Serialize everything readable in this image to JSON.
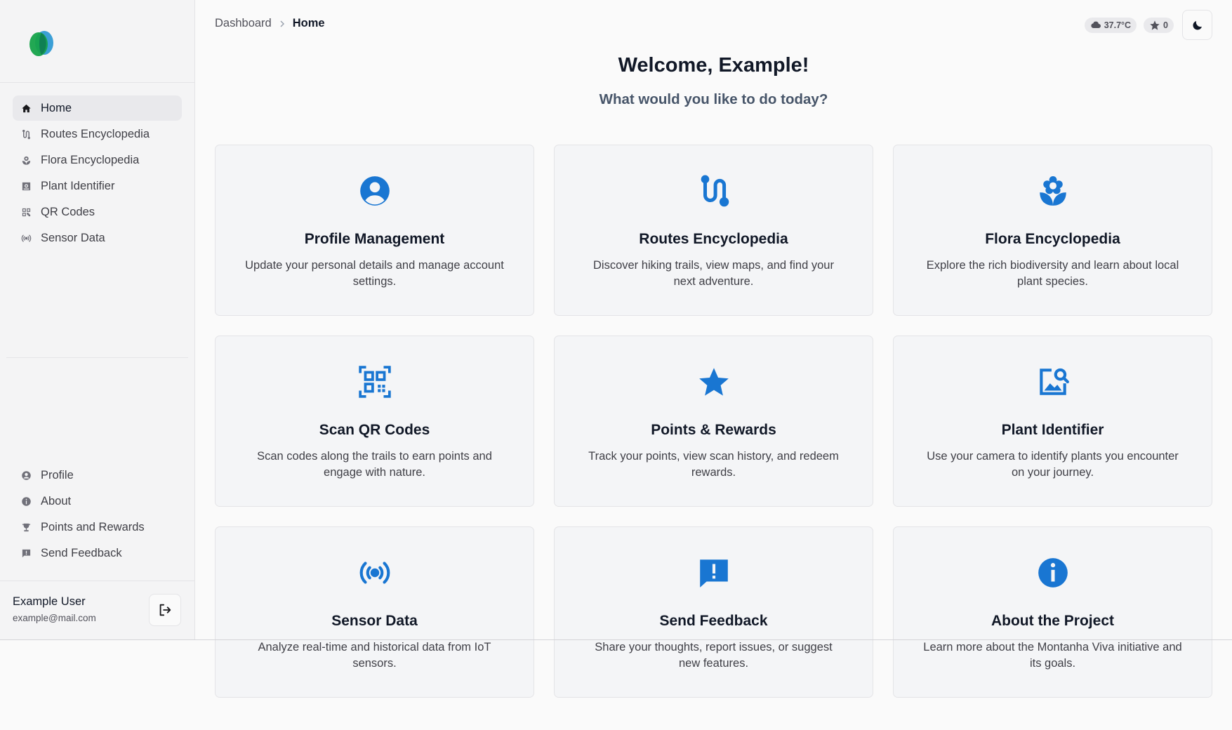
{
  "breadcrumb": {
    "parent": "Dashboard",
    "current": "Home"
  },
  "status": {
    "temperature": "37.7°C",
    "points": "0"
  },
  "welcome": {
    "title": "Welcome, Example!",
    "subtitle": "What would you like to do today?"
  },
  "sidebar": {
    "main_items": [
      {
        "label": "Home",
        "icon": "home-icon",
        "active": true
      },
      {
        "label": "Routes Encyclopedia",
        "icon": "route-icon"
      },
      {
        "label": "Flora Encyclopedia",
        "icon": "flower-icon"
      },
      {
        "label": "Plant Identifier",
        "icon": "scan-image-icon"
      },
      {
        "label": "QR Codes",
        "icon": "qr-code-icon"
      },
      {
        "label": "Sensor Data",
        "icon": "sensor-icon"
      }
    ],
    "bottom_items": [
      {
        "label": "Profile",
        "icon": "user-circle-icon"
      },
      {
        "label": "About",
        "icon": "info-icon"
      },
      {
        "label": "Points and Rewards",
        "icon": "trophy-icon"
      },
      {
        "label": "Send Feedback",
        "icon": "feedback-icon"
      }
    ],
    "user": {
      "name": "Example User",
      "email": "example@mail.com"
    }
  },
  "cards": [
    {
      "title": "Profile Management",
      "description": "Update your personal details and manage account settings.",
      "icon": "user-circle-icon"
    },
    {
      "title": "Routes Encyclopedia",
      "description": "Discover hiking trails, view maps, and find your next adventure.",
      "icon": "route-icon"
    },
    {
      "title": "Flora Encyclopedia",
      "description": "Explore the rich biodiversity and learn about local plant species.",
      "icon": "flower-icon"
    },
    {
      "title": "Scan QR Codes",
      "description": "Scan codes along the trails to earn points and engage with nature.",
      "icon": "qr-code-icon"
    },
    {
      "title": "Points & Rewards",
      "description": "Track your points, view scan history, and redeem rewards.",
      "icon": "star-icon"
    },
    {
      "title": "Plant Identifier",
      "description": "Use your camera to identify plants you encounter on your journey.",
      "icon": "image-search-icon"
    },
    {
      "title": "Sensor Data",
      "description": "Analyze real-time and historical data from IoT sensors.",
      "icon": "sensor-icon"
    },
    {
      "title": "Send Feedback",
      "description": "Share your thoughts, report issues, or suggest new features.",
      "icon": "feedback-icon"
    },
    {
      "title": "About the Project",
      "description": "Learn more about the Montanha Viva initiative and its goals.",
      "icon": "info-icon"
    }
  ],
  "colors": {
    "accent": "#1976d2",
    "logo_green": "#16a34a",
    "logo_blue": "#3b9fd6"
  }
}
